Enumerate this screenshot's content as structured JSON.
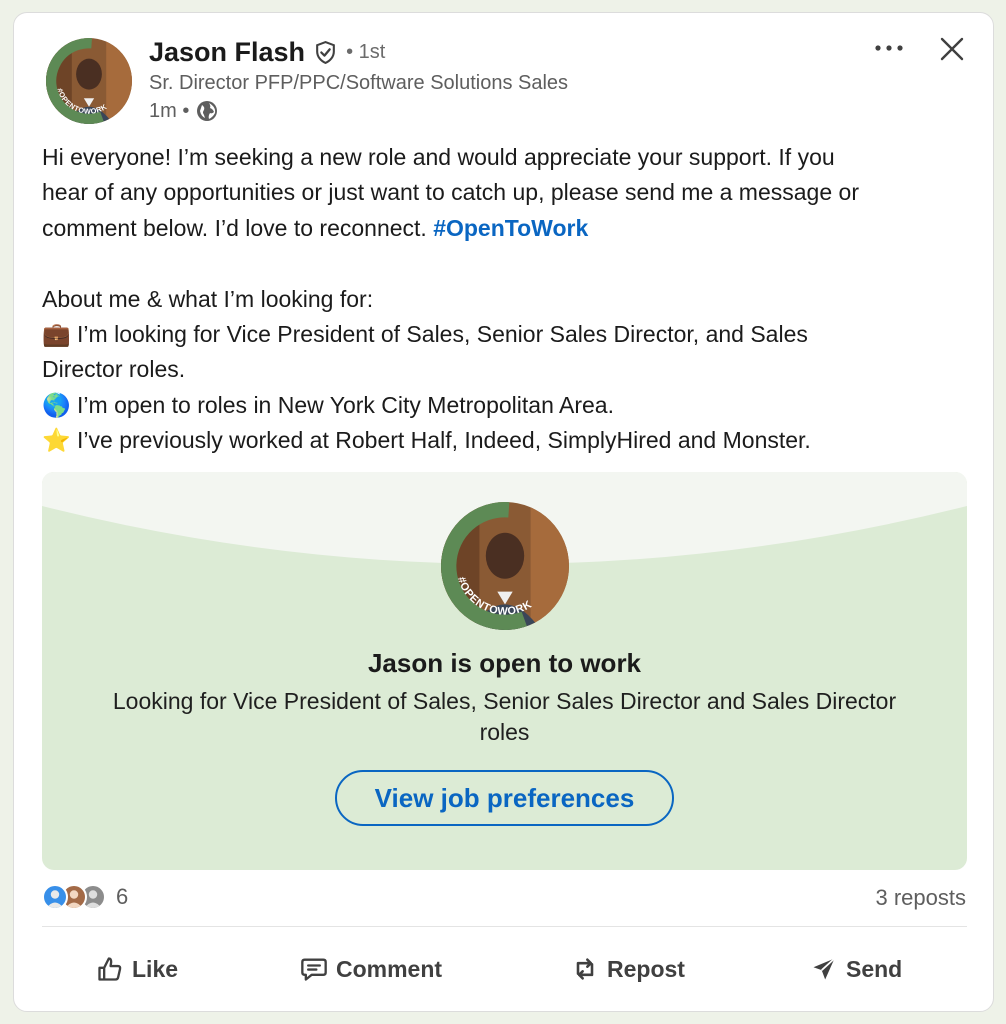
{
  "author": {
    "name": "Jason Flash",
    "degree": "• 1st",
    "headline": "Sr. Director PFP/PPC/Software Solutions Sales",
    "time": "1m •",
    "frame_text": "#OPENTOWORK"
  },
  "post": {
    "lines": [
      "Hi everyone! I’m seeking a new role and would appreciate your support. If you",
      "hear of any opportunities or just want to catch up, please send me a message or",
      "comment below. I’d love to reconnect. "
    ],
    "hashtag": "#OpenToWork",
    "about_heading": "About me & what I’m looking for:",
    "bullets": [
      {
        "emoji": "💼",
        "text": "I’m looking for Vice President of Sales, Senior Sales Director, and Sales"
      },
      {
        "emoji": "",
        "text": "Director roles."
      },
      {
        "emoji": "🌎",
        "text": "I’m open to roles in New York City Metropolitan Area."
      },
      {
        "emoji": "⭐",
        "text": "I’ve previously worked at Robert Half, Indeed, SimplyHired and Monster."
      }
    ]
  },
  "banner": {
    "title": "Jason is open to work",
    "description": "Looking for Vice President of Sales, Senior Sales Director and Sales Director roles",
    "button": "View job preferences",
    "frame_text": "#OPENTOWORK"
  },
  "social": {
    "reaction_count": "6",
    "reposts": "3 reposts"
  },
  "actions": {
    "like": "Like",
    "comment": "Comment",
    "repost": "Repost",
    "send": "Send"
  },
  "colors": {
    "link": "#0a66c2",
    "banner_bg": "#dcebd5",
    "open_to_work_green": "#3d6b44"
  }
}
